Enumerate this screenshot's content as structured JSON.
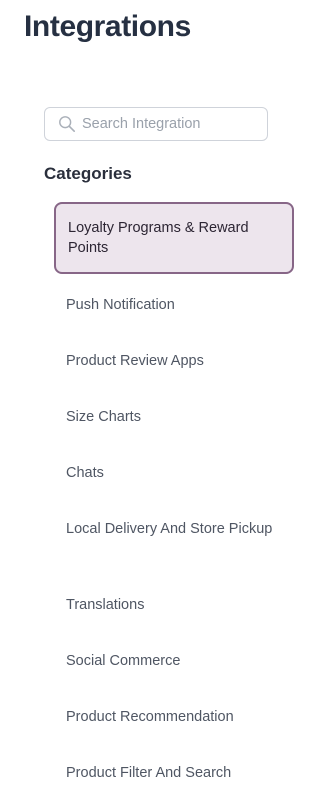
{
  "header": {
    "title": "Integrations"
  },
  "search": {
    "placeholder": "Search Integration",
    "value": ""
  },
  "categories": {
    "heading": "Categories",
    "active_index": 0,
    "items": [
      "Loyalty Programs & Reward Points",
      "Push Notification",
      "Product Review Apps",
      "Size Charts",
      "Chats",
      "Local Delivery And Store Pickup",
      "Translations",
      "Social Commerce",
      "Product Recommendation",
      "Product Filter And Search"
    ]
  },
  "colors": {
    "active_border": "#876687",
    "active_background": "#ede5ed",
    "title": "#263042"
  }
}
